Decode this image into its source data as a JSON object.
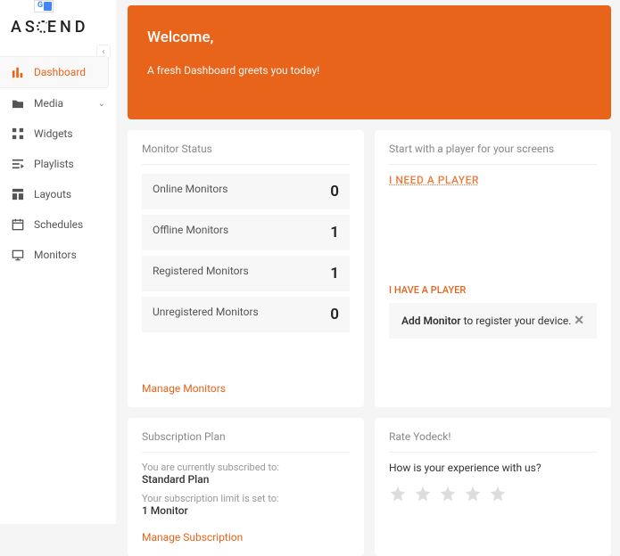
{
  "logo": "ASCEND",
  "sidebar": {
    "items": [
      {
        "label": "Dashboard"
      },
      {
        "label": "Media"
      },
      {
        "label": "Widgets"
      },
      {
        "label": "Playlists"
      },
      {
        "label": "Layouts"
      },
      {
        "label": "Schedules"
      },
      {
        "label": "Monitors"
      }
    ]
  },
  "welcome": {
    "title": "Welcome,",
    "subtitle": "A fresh Dashboard greets you today!"
  },
  "monitor_status": {
    "title": "Monitor Status",
    "rows": [
      {
        "label": "Online Monitors",
        "value": "0"
      },
      {
        "label": "Offline Monitors",
        "value": "1"
      },
      {
        "label": "Registered Monitors",
        "value": "1"
      },
      {
        "label": "Unregistered Monitors",
        "value": "0"
      }
    ],
    "manage": "Manage Monitors"
  },
  "player_start": {
    "title": "Start with a player for your screens",
    "need": "I NEED A PLAYER",
    "have": "I HAVE A PLAYER",
    "tip_bold": "Add Monitor",
    "tip_rest": " to register your device."
  },
  "subscription": {
    "title": "Subscription Plan",
    "note1": "You are currently subscribed to:",
    "plan": "Standard Plan",
    "note2": "Your subscription limit is set to:",
    "limit": "1 Monitor",
    "manage": "Manage Subscription"
  },
  "rate": {
    "title": "Rate Yodeck!",
    "question": "How is your experience with us?"
  }
}
